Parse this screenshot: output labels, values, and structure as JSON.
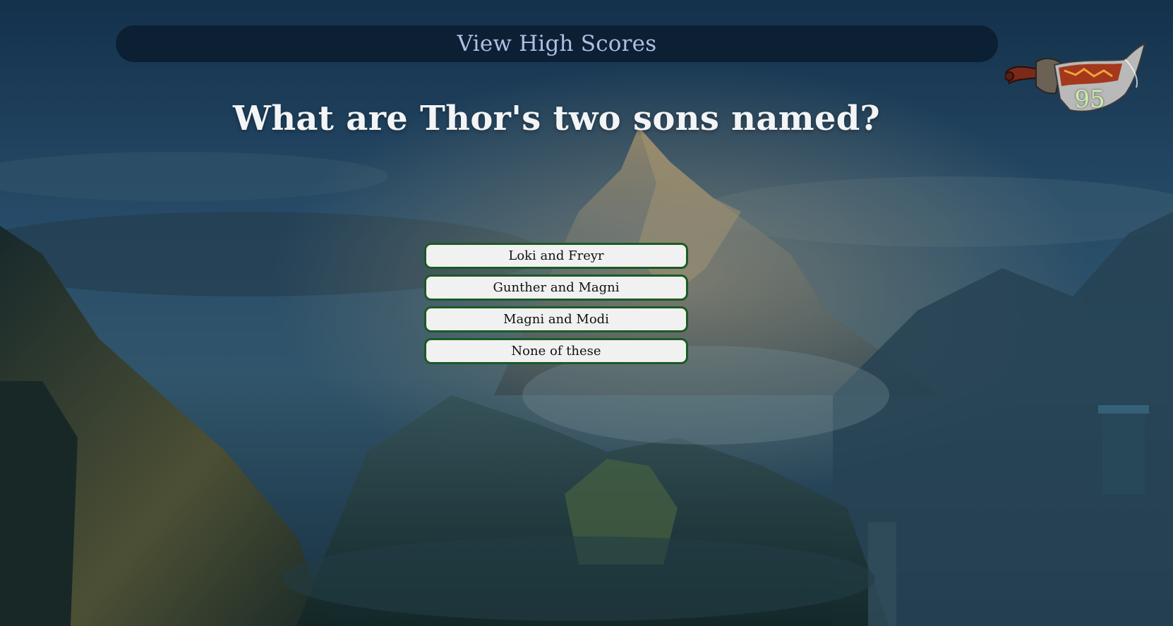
{
  "header": {
    "high_scores_label": "View High Scores"
  },
  "question": {
    "text": "What are Thor's two sons named?"
  },
  "answers": [
    {
      "label": "Loki and Freyr"
    },
    {
      "label": "Gunther and Magni"
    },
    {
      "label": "Magni and Modi"
    },
    {
      "label": "None of these"
    }
  ],
  "timer": {
    "value": "95",
    "icon": "blade-of-chaos-icon"
  },
  "colors": {
    "answer_border": "#1b5a24",
    "answer_bg": "#f1f1f1",
    "header_text": "#aebfe6",
    "timer_text": "#c8f0a8"
  }
}
